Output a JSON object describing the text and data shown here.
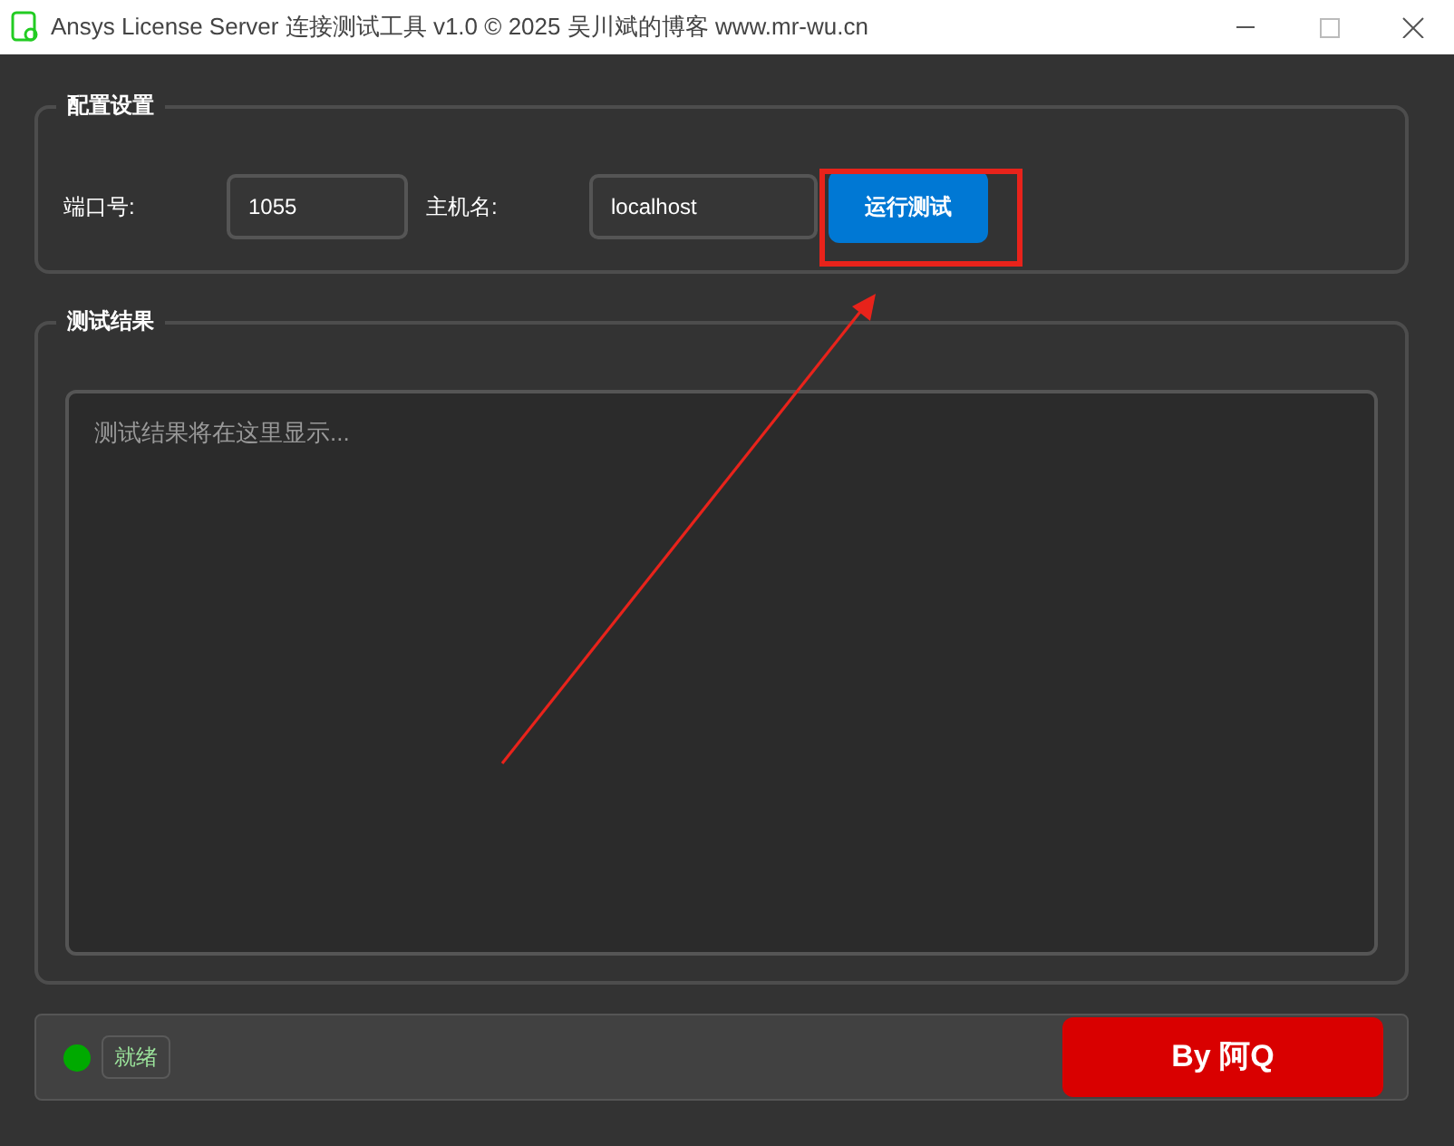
{
  "window": {
    "title": "Ansys License Server 连接测试工具 v1.0 © 2025 吴川斌的博客 www.mr-wu.cn"
  },
  "config": {
    "title": "配置设置",
    "port_label": "端口号:",
    "port_value": "1055",
    "host_label": "主机名:",
    "host_value": "localhost",
    "run_button": "运行测试"
  },
  "results": {
    "title": "测试结果",
    "placeholder": "测试结果将在这里显示..."
  },
  "status": {
    "color": "#00aa00",
    "text": "就绪"
  },
  "author_badge": "By 阿Q"
}
